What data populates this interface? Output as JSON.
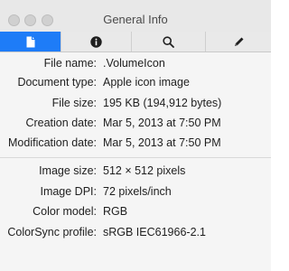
{
  "window": {
    "title": "General Info"
  },
  "tabs": [
    {
      "icon": "document-icon",
      "active": true
    },
    {
      "icon": "info-icon",
      "active": false
    },
    {
      "icon": "search-icon",
      "active": false
    },
    {
      "icon": "pencil-icon",
      "active": false
    }
  ],
  "colors": {
    "accent": "#1e7cf7",
    "titlebar": "#e8e8e8",
    "background": "#f5f5f5"
  },
  "file_info": [
    {
      "label": "File name:",
      "value": ".VolumeIcon"
    },
    {
      "label": "Document type:",
      "value": "Apple icon image"
    },
    {
      "label": "File size:",
      "value": "195 KB (194,912 bytes)"
    },
    {
      "label": "Creation date:",
      "value": "Mar 5, 2013 at 7:50 PM"
    },
    {
      "label": "Modification date:",
      "value": "Mar 5, 2013 at 7:50 PM"
    }
  ],
  "image_info": [
    {
      "label": "Image size:",
      "value": "512 × 512 pixels"
    },
    {
      "label": "Image DPI:",
      "value": "72 pixels/inch"
    },
    {
      "label": "Color model:",
      "value": "RGB"
    },
    {
      "label": "ColorSync profile:",
      "value": "sRGB IEC61966-2.1"
    }
  ]
}
